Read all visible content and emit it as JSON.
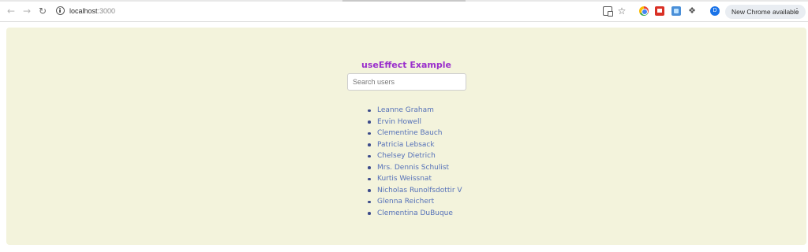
{
  "browser": {
    "url_host": "localhost",
    "url_port": ":3000",
    "profile_initial": "D",
    "update_label": "New Chrome available"
  },
  "icons": {
    "back": "back-arrow-icon",
    "forward": "forward-arrow-icon",
    "reload": "reload-icon",
    "site_info": "info-icon",
    "cast": "cast-icon",
    "bookmark": "star-icon",
    "extension_chrome": "chrome-extension-icon",
    "extension_red": "red-extension-icon",
    "extension_blue": "blue-extension-icon",
    "extensions": "puzzle-icon",
    "menu": "kebab-menu-icon"
  },
  "colors": {
    "card_background": "#f3f3dc",
    "title": "#9a2ecc",
    "list_text": "#5470b8"
  },
  "app": {
    "title": "useEffect Example",
    "search": {
      "placeholder": "Search users",
      "value": ""
    },
    "users": [
      "Leanne Graham",
      "Ervin Howell",
      "Clementine Bauch",
      "Patricia Lebsack",
      "Chelsey Dietrich",
      "Mrs. Dennis Schulist",
      "Kurtis Weissnat",
      "Nicholas Runolfsdottir V",
      "Glenna Reichert",
      "Clementina DuBuque"
    ]
  }
}
